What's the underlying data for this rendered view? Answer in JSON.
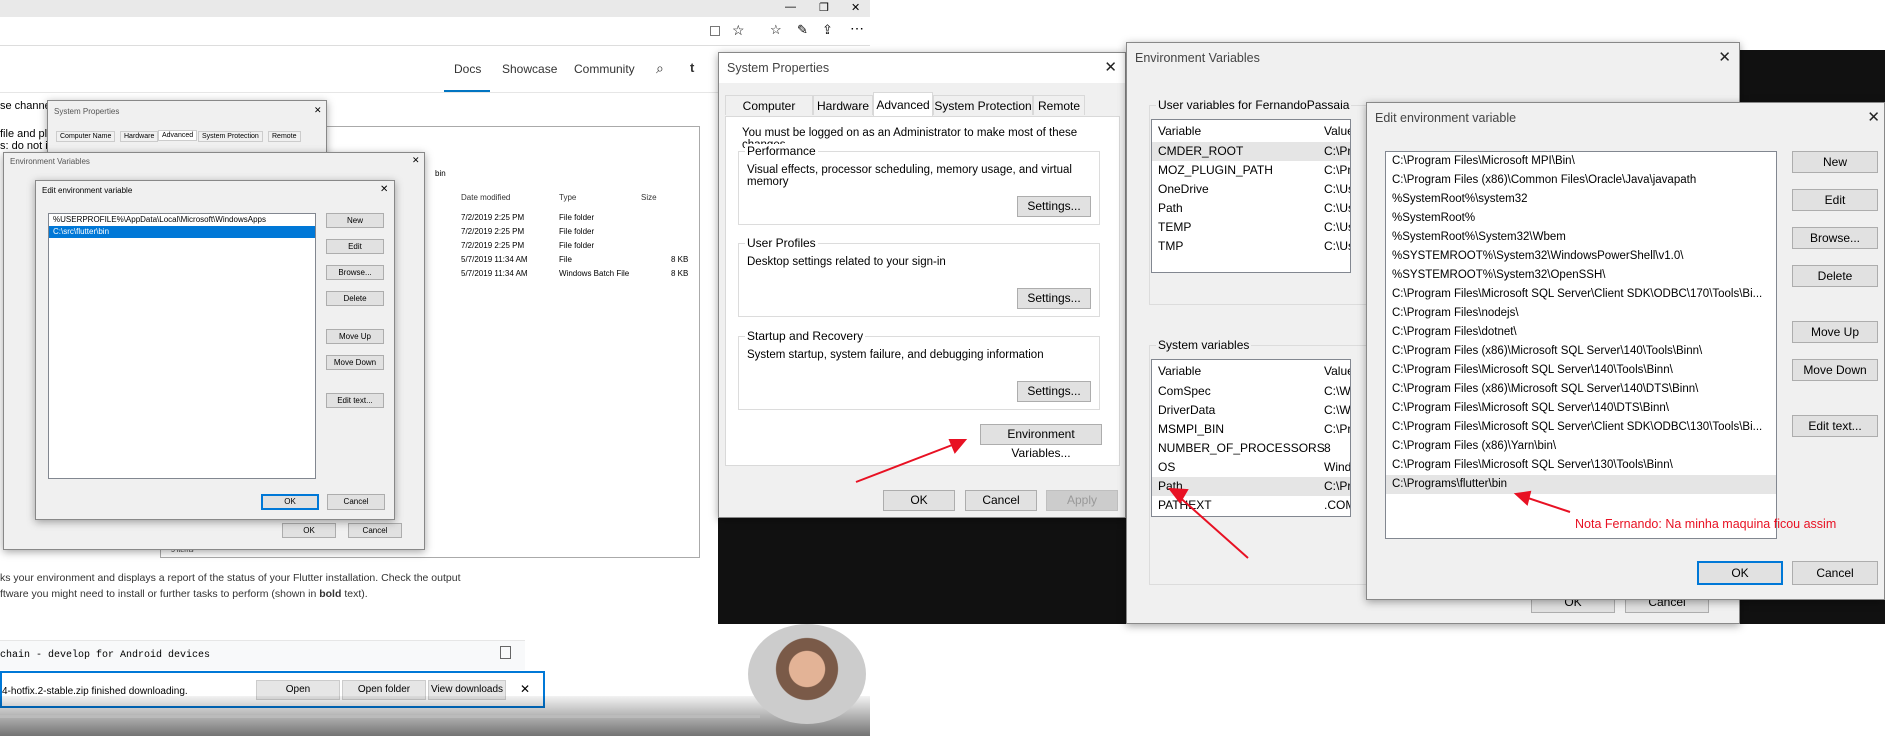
{
  "browser": {
    "top_controls": [
      "—",
      "❐",
      "✕"
    ],
    "nav": {
      "docs": "Docs",
      "showcase": "Showcase",
      "community": "Community"
    },
    "body_line1": "ks your environment and displays a report of the status of your Flutter installation. Check the output",
    "body_line2_a": "ftware you might need to install or further tasks to perform (shown in ",
    "body_bold": "bold",
    "body_line2_b": " text).",
    "left_snippets": [
      "se channe",
      "file and pla",
      "s: do not i"
    ],
    "code_line": "chain - develop for Android devices",
    "download_text": "4-hotfix.2-stable.zip finished downloading.",
    "download_buttons": {
      "open": "Open",
      "open_folder": "Open folder",
      "view_downloads": "View downloads"
    },
    "explorer": {
      "path": "bin",
      "headers": {
        "date": "Date modified",
        "type": "Type",
        "size": "Size"
      },
      "rows": [
        {
          "date": "7/2/2019 2:25 PM",
          "type": "File folder",
          "size": ""
        },
        {
          "date": "7/2/2019 2:25 PM",
          "type": "File folder",
          "size": ""
        },
        {
          "date": "7/2/2019 2:25 PM",
          "type": "File folder",
          "size": ""
        },
        {
          "date": "5/7/2019 11:34 AM",
          "type": "File",
          "size": "8 KB"
        },
        {
          "date": "5/7/2019 11:34 AM",
          "type": "Windows Batch File",
          "size": "8 KB"
        }
      ],
      "status": "5 items"
    }
  },
  "small_sysprops": {
    "title": "System Properties",
    "tabs": [
      "Computer Name",
      "Hardware",
      "Advanced",
      "System Protection",
      "Remote"
    ]
  },
  "small_envvars": {
    "title": "Environment Variables",
    "ok": "OK",
    "cancel": "Cancel"
  },
  "small_edit": {
    "title": "Edit environment variable",
    "entries": [
      "%USERPROFILE%\\AppData\\Local\\Microsoft\\WindowsApps",
      "C:\\src\\flutter\\bin"
    ],
    "buttons": [
      "New",
      "Edit",
      "Browse...",
      "Delete",
      "Move Up",
      "Move Down",
      "Edit text..."
    ],
    "ok": "OK",
    "cancel": "Cancel"
  },
  "sysprops": {
    "title": "System Properties",
    "tabs": [
      "Computer Name",
      "Hardware",
      "Advanced",
      "System Protection",
      "Remote"
    ],
    "admin_note": "You must be logged on as an Administrator to make most of these changes.",
    "perf_title": "Performance",
    "perf_desc": "Visual effects, processor scheduling, memory usage, and virtual memory",
    "profiles_title": "User Profiles",
    "profiles_desc": "Desktop settings related to your sign-in",
    "startup_title": "Startup and Recovery",
    "startup_desc": "System startup, system failure, and debugging information",
    "settings": "Settings...",
    "env_button": "Environment Variables...",
    "ok": "OK",
    "cancel": "Cancel",
    "apply": "Apply"
  },
  "envvars": {
    "title": "Environment Variables",
    "user_group": "User variables for FernandoPassaia",
    "col_variable": "Variable",
    "col_value": "Value",
    "user_vars": [
      {
        "name": "CMDER_ROOT",
        "value": "C:\\Prog"
      },
      {
        "name": "MOZ_PLUGIN_PATH",
        "value": "C:\\Prog"
      },
      {
        "name": "OneDrive",
        "value": "C:\\User"
      },
      {
        "name": "Path",
        "value": "C:\\User"
      },
      {
        "name": "TEMP",
        "value": "C:\\User"
      },
      {
        "name": "TMP",
        "value": "C:\\User"
      }
    ],
    "system_group": "System variables",
    "system_vars": [
      {
        "name": "ComSpec",
        "value": "C:\\Wind"
      },
      {
        "name": "DriverData",
        "value": "C:\\Wind"
      },
      {
        "name": "MSMPI_BIN",
        "value": "C:\\Prog"
      },
      {
        "name": "NUMBER_OF_PROCESSORS",
        "value": "8"
      },
      {
        "name": "OS",
        "value": "Window"
      },
      {
        "name": "Path",
        "value": "C:\\Prog"
      },
      {
        "name": "PATHEXT",
        "value": ".COM;.E"
      }
    ],
    "ok": "OK",
    "cancel": "Cancel"
  },
  "editenv": {
    "title": "Edit environment variable",
    "entries": [
      "C:\\Program Files\\Microsoft MPI\\Bin\\",
      "C:\\Program Files (x86)\\Common Files\\Oracle\\Java\\javapath",
      "%SystemRoot%\\system32",
      "%SystemRoot%",
      "%SystemRoot%\\System32\\Wbem",
      "%SYSTEMROOT%\\System32\\WindowsPowerShell\\v1.0\\",
      "%SYSTEMROOT%\\System32\\OpenSSH\\",
      "C:\\Program Files\\Microsoft SQL Server\\Client SDK\\ODBC\\170\\Tools\\Bi...",
      "C:\\Program Files\\nodejs\\",
      "C:\\Program Files\\dotnet\\",
      "C:\\Program Files (x86)\\Microsoft SQL Server\\140\\Tools\\Binn\\",
      "C:\\Program Files\\Microsoft SQL Server\\140\\Tools\\Binn\\",
      "C:\\Program Files (x86)\\Microsoft SQL Server\\140\\DTS\\Binn\\",
      "C:\\Program Files\\Microsoft SQL Server\\140\\DTS\\Binn\\",
      "C:\\Program Files\\Microsoft SQL Server\\Client SDK\\ODBC\\130\\Tools\\Bi...",
      "C:\\Program Files (x86)\\Yarn\\bin\\",
      "C:\\Program Files\\Microsoft SQL Server\\130\\Tools\\Binn\\",
      "C:\\Programs\\flutter\\bin"
    ],
    "buttons": {
      "new": "New",
      "edit": "Edit",
      "browse": "Browse...",
      "delete": "Delete",
      "move_up": "Move Up",
      "move_down": "Move Down",
      "edit_text": "Edit text..."
    },
    "ok": "OK",
    "cancel": "Cancel"
  },
  "annotation": {
    "text": "Nota Fernando: Na minha maquina ficou assim",
    "color": "#e81123"
  },
  "video_time": "2019"
}
